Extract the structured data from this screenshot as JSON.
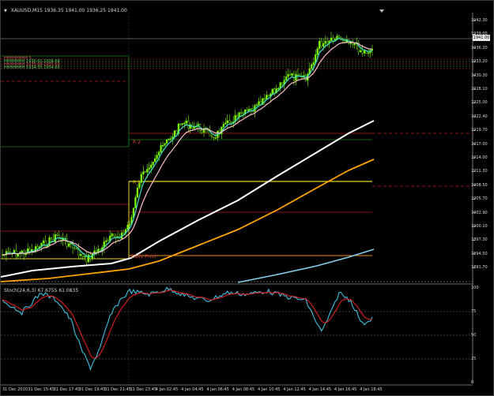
{
  "chart": {
    "symbol_line": "XAUUSD,M15  1936.35 1941.00 1936.25 1941.00",
    "indicator_line": "Stoch(24,6,3) 67.6755 61.0835",
    "current_price": "1941.00",
    "price_axis": [
      "1942.30",
      "1939.00",
      "1936.20",
      "1933.20",
      "1930.30",
      "1928.10",
      "1925.00",
      "1922.40",
      "1919.70",
      "1917.00",
      "1914.00",
      "1911.30",
      "1908.50",
      "1905.70",
      "1902.90",
      "1900.10",
      "1897.30",
      "1894.50",
      "1891.70"
    ],
    "osc_axis": [
      "100",
      "75",
      "50",
      "25",
      "0"
    ],
    "time_axis": [
      "31 Dec 2020",
      "31 Dec 15:45",
      "31 Dec 17:45",
      "31 Dec 19:45",
      "31 Dec 21:45",
      "31 Dec 23:45",
      "4 Jan 02:45",
      "4 Jan 04:45",
      "4 Jan 06:45",
      "4 Jan 08:45",
      "4 Jan 10:45",
      "4 Jan 12:45",
      "4 Jan 14:45",
      "4 Jan 16:45",
      "4 Jan 18:45"
    ],
    "pivot_labels": [
      "R 2",
      "R 1",
      "Daily Pivot"
    ],
    "zone_labels": [
      "HHHHHHHH 5",
      "HHHHHHH 1936.61 1936.69",
      "HHHHHHH 1935.64 1935.69",
      "HHHHHHH 1934.55 1934.60"
    ]
  },
  "colors": {
    "candle": "#7CFC00",
    "ma_fast": "#40E0D0",
    "ma_slow": "#FFC0CB",
    "ma_white": "#FFFFFF",
    "ma_orange": "#FFA500",
    "ma_blue": "#87CEEB",
    "stoch_main": "#40C0E0",
    "stoch_signal": "#E02020",
    "pivot_yellow": "#E8D020",
    "pivot_red": "#B02020",
    "pivot_green": "#208020"
  }
}
